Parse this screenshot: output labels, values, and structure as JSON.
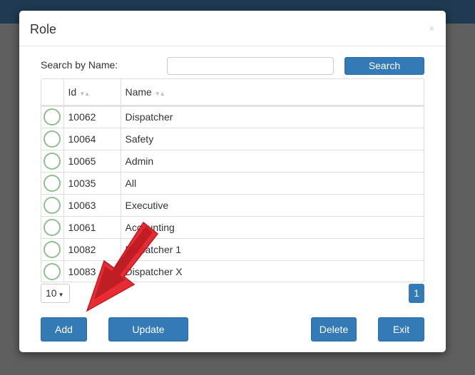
{
  "dialog": {
    "title": "Role",
    "close_glyph": "×"
  },
  "search": {
    "label": "Search by Name:",
    "value": "",
    "placeholder": "",
    "button": "Search"
  },
  "table": {
    "columns": [
      {
        "label": "Id",
        "sort_icon": "sort-arrows-icon"
      },
      {
        "label": "Name",
        "sort_icon": "sort-arrows-icon"
      }
    ],
    "rows": [
      {
        "id": "10062",
        "name": "Dispatcher"
      },
      {
        "id": "10064",
        "name": "Safety"
      },
      {
        "id": "10065",
        "name": "Admin"
      },
      {
        "id": "10035",
        "name": "All"
      },
      {
        "id": "10063",
        "name": "Executive"
      },
      {
        "id": "10061",
        "name": "Accounting"
      },
      {
        "id": "10082",
        "name": "Dispatcher 1"
      },
      {
        "id": "10083",
        "name": "Dispatcher X"
      }
    ]
  },
  "pagination": {
    "page_size": "10",
    "current_page": "1"
  },
  "buttons": {
    "add": "Add",
    "update": "Update",
    "delete": "Delete",
    "exit": "Exit"
  },
  "colors": {
    "primary": "#337ab7",
    "radio_border": "#8fbf8f",
    "annotation_arrow": "#e8202a"
  },
  "annotation": {
    "icon": "red-arrow-icon",
    "points_to": "add-button"
  }
}
